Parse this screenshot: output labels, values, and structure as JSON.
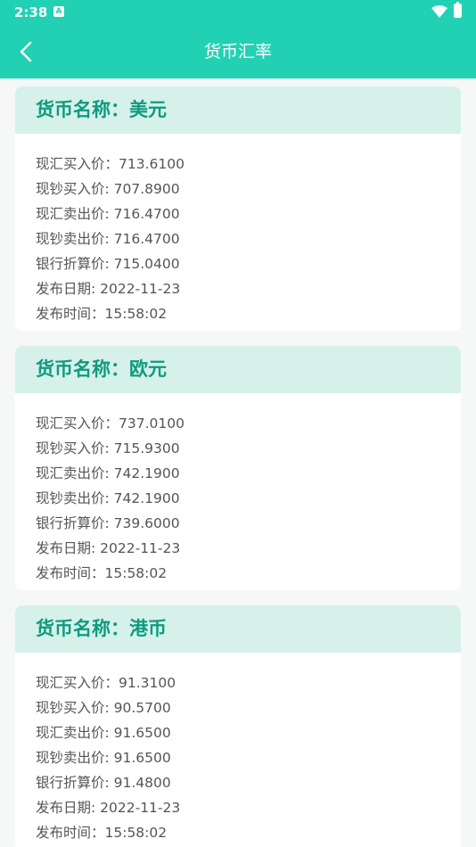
{
  "status_bar": {
    "time": "2:38",
    "notification_icon": "A",
    "icons": [
      "wifi-icon",
      "battery-icon"
    ]
  },
  "app_bar": {
    "title": "货币汇率",
    "back_icon": "chevron-left-icon"
  },
  "colors": {
    "primary": "#22d0b3",
    "card_header_bg": "#d5f1ea",
    "card_title": "#0f9a7e",
    "row_text": "#555555",
    "page_bg": "#f6f7f7"
  },
  "cards": [
    {
      "title": "货币名称：美元",
      "rows": [
        "现汇买入价：713.6100",
        "现钞买入价: 707.8900",
        "现汇卖出价: 716.4700",
        "现钞卖出价: 716.4700",
        "银行折算价: 715.0400",
        "发布日期: 2022-11-23",
        "发布时间：15:58:02"
      ]
    },
    {
      "title": "货币名称：欧元",
      "rows": [
        "现汇买入价：737.0100",
        "现钞买入价: 715.9300",
        "现汇卖出价: 742.1900",
        "现钞卖出价: 742.1900",
        "银行折算价: 739.6000",
        "发布日期: 2022-11-23",
        "发布时间：15:58:02"
      ]
    },
    {
      "title": "货币名称：港币",
      "rows": [
        "现汇买入价：91.3100",
        "现钞买入价: 90.5700",
        "现汇卖出价: 91.6500",
        "现钞卖出价: 91.6500",
        "银行折算价: 91.4800",
        "发布日期: 2022-11-23",
        "发布时间：15:58:02"
      ]
    }
  ]
}
